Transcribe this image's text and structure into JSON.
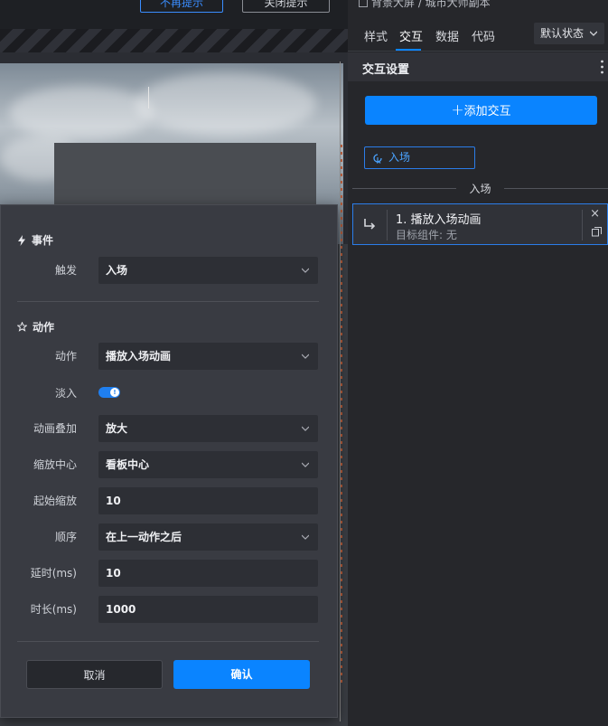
{
  "canvas": {
    "top_buttons": [
      "不再提示",
      "关闭提示"
    ]
  },
  "dialog": {
    "event_section": "事件",
    "trigger": {
      "label": "触发",
      "value": "入场"
    },
    "action_section": "动作",
    "fields": [
      {
        "label": "动作",
        "value": "播放入场动画",
        "type": "select"
      },
      {
        "label": "淡入",
        "value": "on",
        "type": "toggle"
      },
      {
        "label": "动画叠加",
        "value": "放大",
        "type": "select"
      },
      {
        "label": "缩放中心",
        "value": "看板中心",
        "type": "select"
      },
      {
        "label": "起始缩放",
        "value": "10",
        "type": "input"
      },
      {
        "label": "顺序",
        "value": "在上一动作之后",
        "type": "select"
      },
      {
        "label": "延时(ms)",
        "value": "10",
        "type": "input"
      },
      {
        "label": "时长(ms)",
        "value": "1000",
        "type": "input"
      }
    ],
    "cancel": "取消",
    "confirm": "确认"
  },
  "panel": {
    "breadcrumb": "背景大屏 / 城市大师副本",
    "tabs": [
      "样式",
      "交互",
      "数据",
      "代码"
    ],
    "active_tab": "交互",
    "state_select": "默认状态",
    "section_title": "交互设置",
    "add_button": "添加交互",
    "event_tag": "入场",
    "group_label": "入场",
    "action_item": {
      "title": "1. 播放入场动画",
      "subtitle": "目标组件: 无"
    }
  },
  "colors": {
    "accent": "#0a84ff",
    "dialog_bg": "#393b42",
    "panel_bg": "#26272b"
  }
}
